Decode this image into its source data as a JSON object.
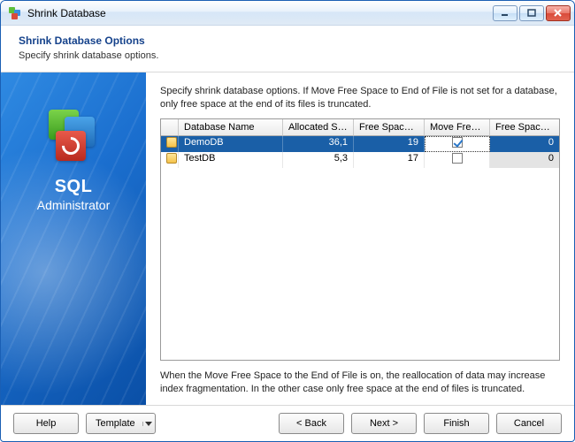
{
  "window": {
    "title": "Shrink Database"
  },
  "header": {
    "title": "Shrink Database Options",
    "subtitle": "Specify shrink database options."
  },
  "sidebar": {
    "brand_line1": "SQL",
    "brand_line2": "Administrator"
  },
  "main": {
    "description": "Specify shrink database options. If Move Free Space to End of File is not set for a database, only free space at the end of its files is truncated.",
    "note": "When the Move Free Space to the End of File is on, the reallocation of data may increase index fragmentation. In the other case only free space at the end of files is truncated."
  },
  "grid": {
    "columns": {
      "name": "Database Name",
      "allocated": "Allocated Sp...",
      "free": "Free Space,...",
      "move": "Move Free ...",
      "after": "Free Space ..."
    },
    "rows": [
      {
        "name": "DemoDB",
        "allocated": "36,1",
        "free": "19",
        "move": true,
        "after": "0",
        "selected": true
      },
      {
        "name": "TestDB",
        "allocated": "5,3",
        "free": "17",
        "move": false,
        "after": "0",
        "selected": false
      }
    ]
  },
  "buttons": {
    "help": "Help",
    "template": "Template",
    "back": "< Back",
    "next": "Next >",
    "finish": "Finish",
    "cancel": "Cancel"
  }
}
